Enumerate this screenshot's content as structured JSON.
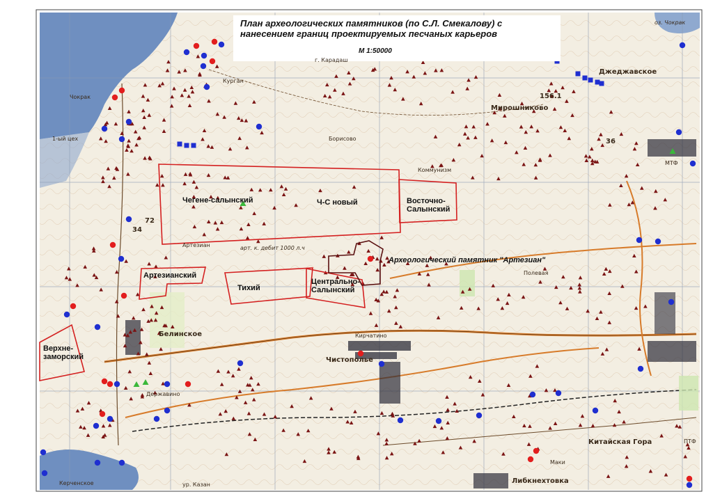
{
  "title": "План археологических памятников (по С.Л. Смекалову) с\nнанесением границ проектируемых песчаных карьеров",
  "scale": "М 1:50000",
  "monument_label": "Археологический памятник \"Артезиан\"",
  "colors": {
    "sea": "#6f8fc0",
    "land": "#f2ede2",
    "quarry_border": "#d42020",
    "monument_border": "#5a1010",
    "mound": "#7a1414",
    "site_red": "#e21e1e",
    "site_blue": "#1f2fd0",
    "site_green": "#3ab83a",
    "grid": "#8a9bb3"
  },
  "quarries": [
    {
      "name": "Чегене-салынский"
    },
    {
      "name": "Ч-С новый"
    },
    {
      "name": "Восточно-\nСалынский"
    },
    {
      "name": "Артезианский"
    },
    {
      "name": "Тихий"
    },
    {
      "name": "Центрально-\nСалынский"
    },
    {
      "name": "Верхне-\nзаморский"
    }
  ],
  "map_labels": [
    "Чистополье",
    "Белинское",
    "Мирошниково",
    "Джеджавское",
    "Китайская Гора",
    "Либкнехтовка",
    "Керченское",
    "оз. Чокрак",
    "г. Карадаш",
    "Курган",
    "арт. к. дебит 1000 л.ч",
    "Кирчатино",
    "МТФ",
    "ПТФ",
    "ур. Казан",
    "Маки",
    "Державино",
    "1-ый цех",
    "Чокрак",
    "72",
    "34",
    "36",
    "156.1",
    "Полевая",
    "Борисово",
    "Коммунизм",
    "Артезиан"
  ]
}
